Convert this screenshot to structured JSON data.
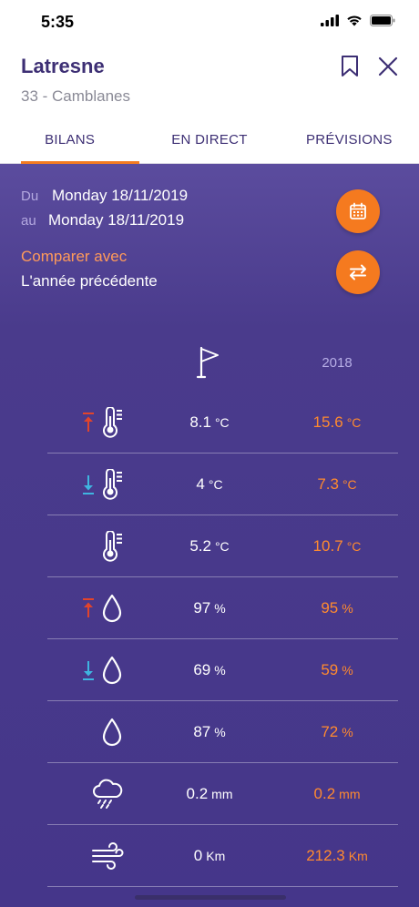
{
  "status": {
    "time": "5:35"
  },
  "header": {
    "city": "Latresne",
    "subtitle": "33 - Camblanes"
  },
  "tabs": [
    {
      "label": "BILANS",
      "active": true
    },
    {
      "label": "EN DIRECT",
      "active": false
    },
    {
      "label": "PRÉVISIONS",
      "active": false
    }
  ],
  "period": {
    "from_label": "Du",
    "from_value": "Monday 18/11/2019",
    "to_label": "au",
    "to_value": "Monday 18/11/2019"
  },
  "compare": {
    "label": "Comparer avec",
    "value": "L'année précédente"
  },
  "columns": {
    "compare_year": "2018"
  },
  "rows": [
    {
      "icon": "max-temperature",
      "value": "8.1",
      "unit": "°C",
      "compare_value": "15.6",
      "compare_unit": "°C"
    },
    {
      "icon": "min-temperature",
      "value": "4",
      "unit": "°C",
      "compare_value": "7.3",
      "compare_unit": "°C"
    },
    {
      "icon": "avg-temperature",
      "value": "5.2",
      "unit": "°C",
      "compare_value": "10.7",
      "compare_unit": "°C"
    },
    {
      "icon": "max-humidity",
      "value": "97",
      "unit": "%",
      "compare_value": "95",
      "compare_unit": "%"
    },
    {
      "icon": "min-humidity",
      "value": "69",
      "unit": "%",
      "compare_value": "59",
      "compare_unit": "%"
    },
    {
      "icon": "avg-humidity",
      "value": "87",
      "unit": "%",
      "compare_value": "72",
      "compare_unit": "%"
    },
    {
      "icon": "rain",
      "value": "0.2",
      "unit": "mm",
      "compare_value": "0.2",
      "compare_unit": "mm"
    },
    {
      "icon": "wind",
      "value": "0",
      "unit": "Km",
      "compare_value": "212.3",
      "compare_unit": "Km"
    }
  ],
  "colors": {
    "accent": "#f57a1f",
    "primary": "#3d2f74",
    "up_arrow": "#e2442b",
    "down_arrow": "#3fb5e0",
    "compare": "#ff8a2f"
  }
}
